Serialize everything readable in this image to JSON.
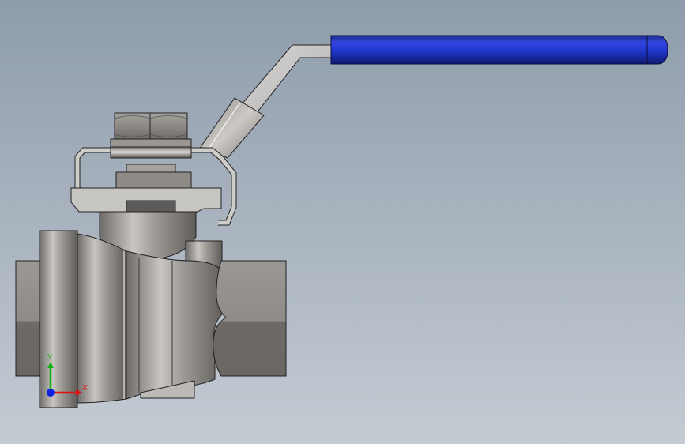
{
  "viewport": {
    "background_top": "#8e9cab",
    "background_bottom": "#c4cbd3"
  },
  "model": {
    "handle_grip_color": "#2233cc",
    "body_metal_color": "#8f8c89",
    "edge_color": "#1e1e1e"
  },
  "triad": {
    "x_label": "X",
    "y_label": "Y",
    "x_color": "#e01010",
    "y_color": "#10b010",
    "z_color": "#1020e0"
  }
}
